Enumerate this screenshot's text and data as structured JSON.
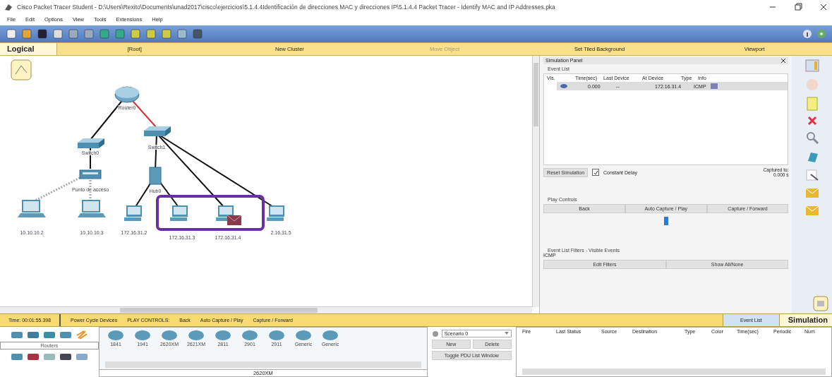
{
  "window": {
    "title": "Cisco Packet Tracer Student - D:\\Users\\Rexito\\Documents\\unad2017\\cisco\\ejercicios\\5.1.4.4Identificación de direcciones MAC y direcciones IP\\5.1.4.4 Packet Tracer - Identify MAC and IP Addresses.pka"
  },
  "menu": [
    "File",
    "Edit",
    "Options",
    "View",
    "Tools",
    "Extensions",
    "Help"
  ],
  "workspace_bar": {
    "mode": "Logical",
    "items": [
      {
        "label": "[Root]",
        "disabled": false
      },
      {
        "label": "New Cluster",
        "disabled": false
      },
      {
        "label": "Move Object",
        "disabled": true
      },
      {
        "label": "Set Tiled Background",
        "disabled": false
      },
      {
        "label": "Viewport",
        "disabled": false
      }
    ]
  },
  "topology": {
    "devices": [
      {
        "kind": "router",
        "label": "Router0"
      },
      {
        "kind": "switch",
        "label": "Switch0"
      },
      {
        "kind": "switch",
        "label": "Switch1"
      },
      {
        "kind": "access_point",
        "label": "Punto de acceso"
      },
      {
        "kind": "hub",
        "label": "Hub0"
      },
      {
        "kind": "laptop",
        "label": "10.10.10.2"
      },
      {
        "kind": "laptop",
        "label": "10.10.10.3"
      },
      {
        "kind": "pc",
        "label": "172.16.31.2"
      },
      {
        "kind": "pc",
        "label": "172.16.31.3"
      },
      {
        "kind": "pc",
        "label": "172.16.31.4",
        "pdu": true
      },
      {
        "kind": "pc",
        "label": "2.16.31.5"
      }
    ]
  },
  "sim_panel": {
    "title": "Simulation Panel",
    "event_list": {
      "title": "Event List",
      "columns": [
        "Vis.",
        "Time(sec)",
        "Last Device",
        "At Device",
        "Type",
        "Info"
      ],
      "rows": [
        {
          "time": "0.000",
          "last_device": "--",
          "at_device": "172.16.31.4",
          "type": "ICMP",
          "color": "#8080b8"
        }
      ]
    },
    "reset_button": "Reset Simulation",
    "constant_delay": {
      "label": "Constant Delay",
      "checked": true
    },
    "captured_to": {
      "label": "Captured to:",
      "value": "0.000 s"
    },
    "play_controls": {
      "title": "Play Controls",
      "buttons": [
        "Back",
        "Auto Capture / Play",
        "Capture / Forward"
      ],
      "level": 0.5
    },
    "filters": {
      "title": "Event List Filters - Visible Events",
      "value": "ICMP",
      "buttons": [
        "Edit Filters",
        "Show All/None"
      ]
    }
  },
  "status_bar": {
    "time": "Time: 00:01:55.398",
    "items": [
      "Power Cycle Devices",
      "PLAY CONTROLS:",
      "Back",
      "Auto Capture / Play",
      "Capture / Forward"
    ],
    "event_list": {
      "label": "Event List",
      "selected": true
    },
    "mode": "Simulation"
  },
  "device_panel": {
    "category": "Routers",
    "models": [
      "1841",
      "1941",
      "2620XM",
      "2621XM",
      "2811",
      "2901",
      "2911",
      "Generic",
      "Generic"
    ],
    "selected_model": "2620XM"
  },
  "scenario": {
    "value": "Scenario 0",
    "buttons": [
      "New",
      "Delete",
      "Toggle PDU List Window"
    ]
  },
  "pdu_list": {
    "columns": [
      "Fire",
      "Last Status",
      "Source",
      "Destination",
      "Type",
      "Color",
      "Time(sec)",
      "Periodic",
      "Num"
    ]
  }
}
